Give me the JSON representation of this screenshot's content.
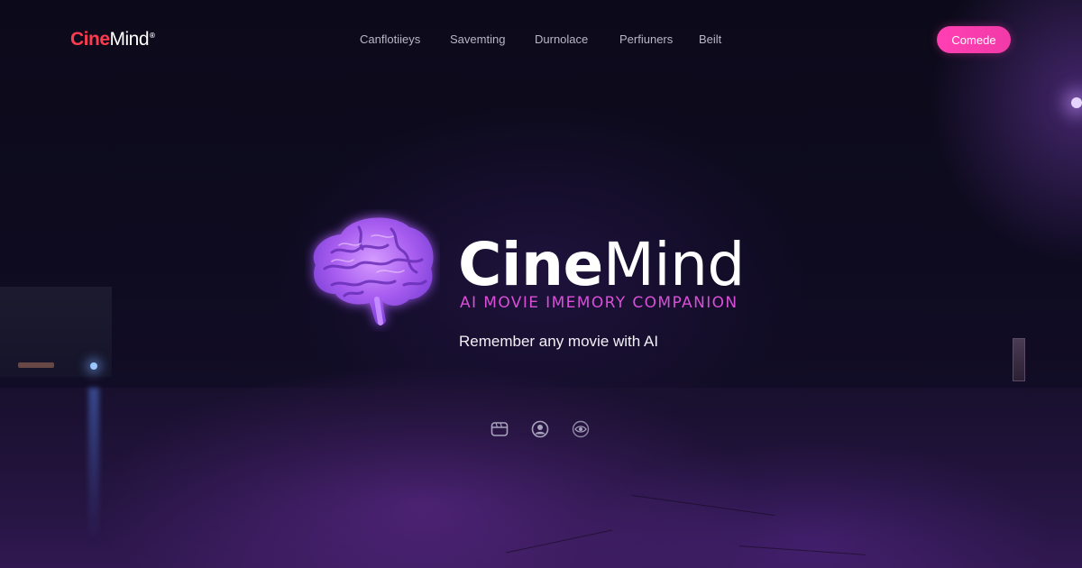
{
  "brand": {
    "logo_cine": "Cine",
    "logo_mind": "Mind",
    "logo_mark": "®",
    "accent_color": "#ff3b4f"
  },
  "nav": {
    "items": [
      {
        "label": "Canflotiieys"
      },
      {
        "label": "Savemting"
      },
      {
        "label": "Durnolace"
      },
      {
        "label": "Perfiuners"
      },
      {
        "label": "Beilt"
      }
    ],
    "cta_label": "Comede",
    "cta_color": "#ff3fb3"
  },
  "hero": {
    "icon": "brain-icon",
    "title_cine": "Cine",
    "title_mind": "Mind",
    "subtitle": "AI MOVIE IMEMORY COMPANION",
    "subtitle_color": "#d94fd8",
    "tagline": "Remember any movie with AI"
  },
  "features": {
    "icons": [
      "film-icon",
      "user-circle-icon",
      "eye-icon"
    ]
  }
}
